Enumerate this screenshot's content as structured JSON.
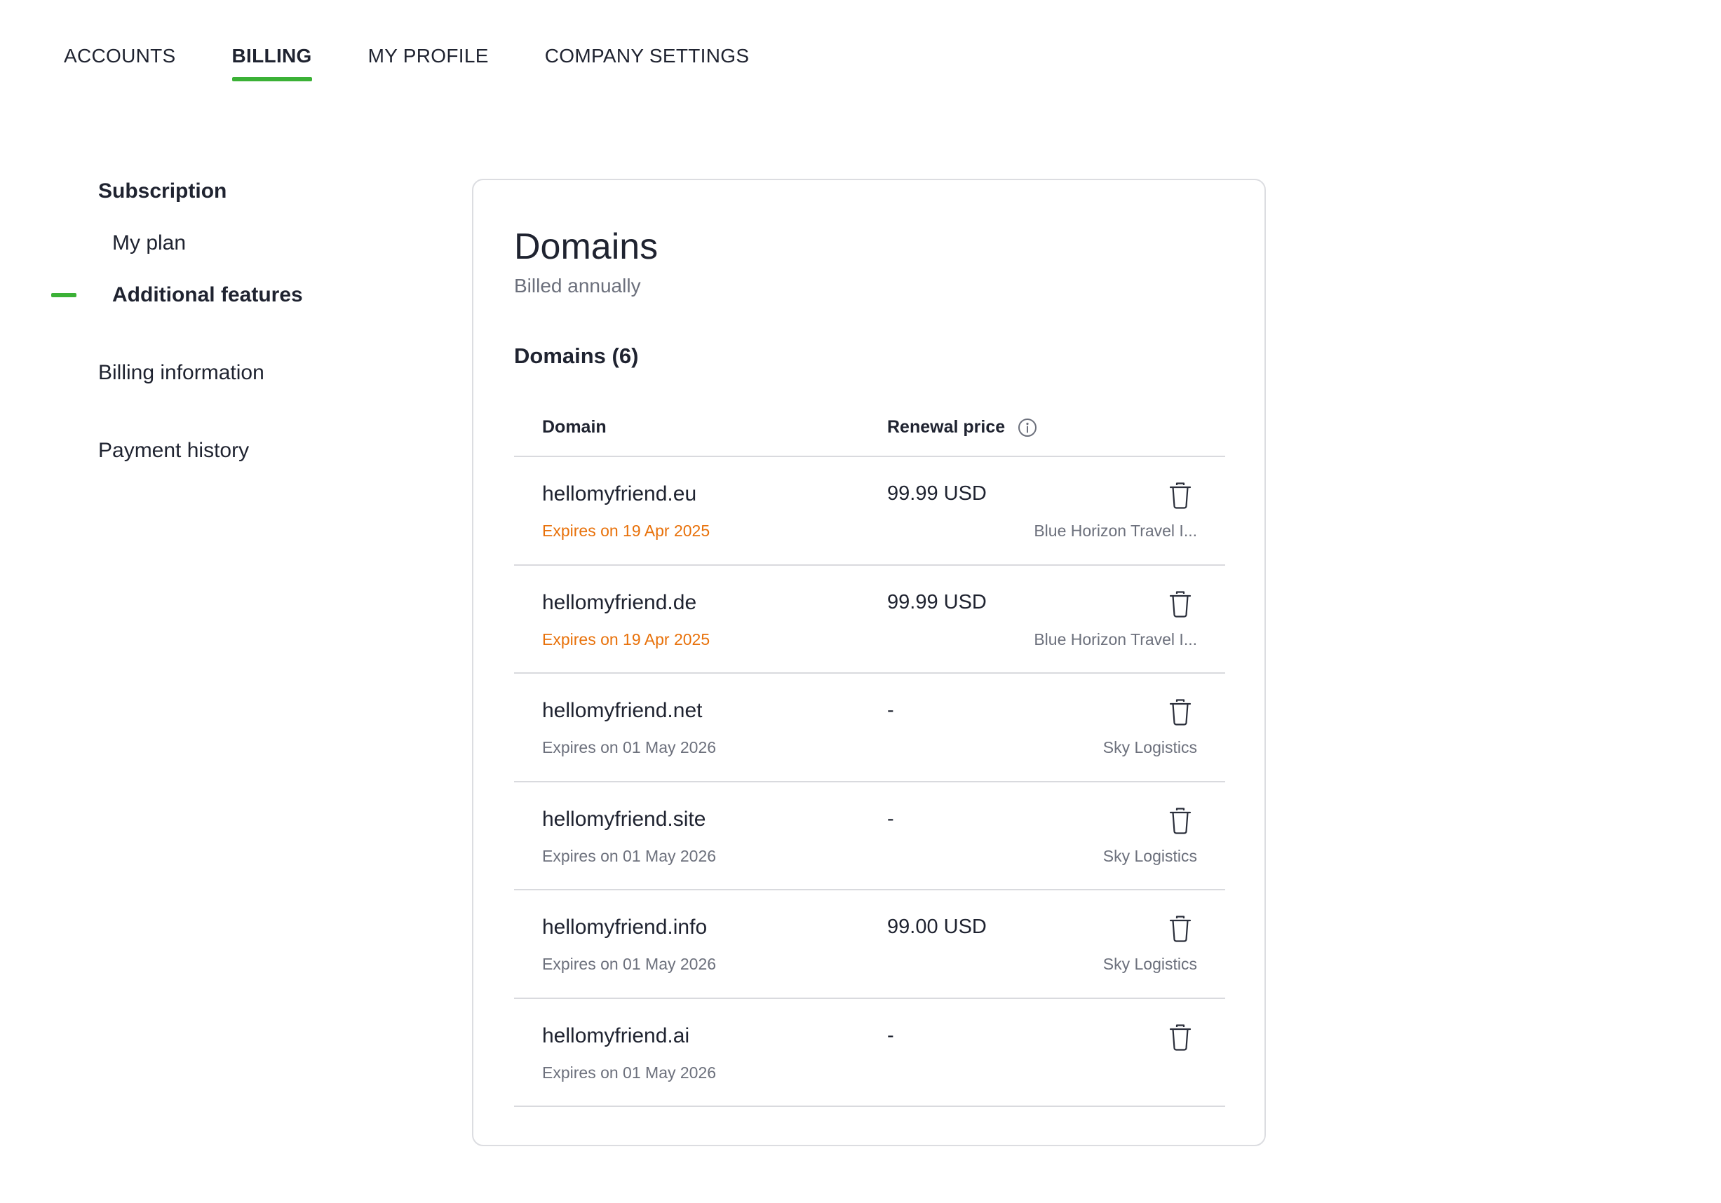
{
  "tabs": {
    "accounts": "ACCOUNTS",
    "billing": "BILLING",
    "profile": "MY PROFILE",
    "company": "COMPANY SETTINGS",
    "active": "BILLING"
  },
  "sidebar": {
    "subscription": "Subscription",
    "my_plan": "My plan",
    "additional_features": "Additional features",
    "billing_information": "Billing information",
    "payment_history": "Payment history",
    "active": "Additional features"
  },
  "card": {
    "title": "Domains",
    "subtitle": "Billed annually",
    "section_title": "Domains (6)"
  },
  "table": {
    "headers": {
      "domain": "Domain",
      "renewal_price": "Renewal price"
    },
    "rows": [
      {
        "domain": "hellomyfriend.eu",
        "expiry": "Expires on 19 Apr 2025",
        "expiry_warning": true,
        "price": "99.99 USD",
        "company": "Blue Horizon Travel I..."
      },
      {
        "domain": "hellomyfriend.de",
        "expiry": "Expires on 19 Apr 2025",
        "expiry_warning": true,
        "price": "99.99 USD",
        "company": "Blue Horizon Travel I..."
      },
      {
        "domain": "hellomyfriend.net",
        "expiry": "Expires on 01 May 2026",
        "expiry_warning": false,
        "price": "-",
        "company": "Sky Logistics"
      },
      {
        "domain": "hellomyfriend.site",
        "expiry": "Expires on 01 May 2026",
        "expiry_warning": false,
        "price": "-",
        "company": "Sky Logistics"
      },
      {
        "domain": "hellomyfriend.info",
        "expiry": "Expires on 01 May 2026",
        "expiry_warning": false,
        "price": "99.00 USD",
        "company": "Sky Logistics"
      },
      {
        "domain": "hellomyfriend.ai",
        "expiry": "Expires on 01 May 2026",
        "expiry_warning": false,
        "price": "-",
        "company": ""
      }
    ]
  },
  "colors": {
    "accent": "#3bb136",
    "warning": "#e8710a",
    "muted": "#6c707c",
    "text": "#1f2330",
    "border": "#d9dade"
  },
  "icons": {
    "info": "info-icon",
    "delete": "trash-icon"
  }
}
